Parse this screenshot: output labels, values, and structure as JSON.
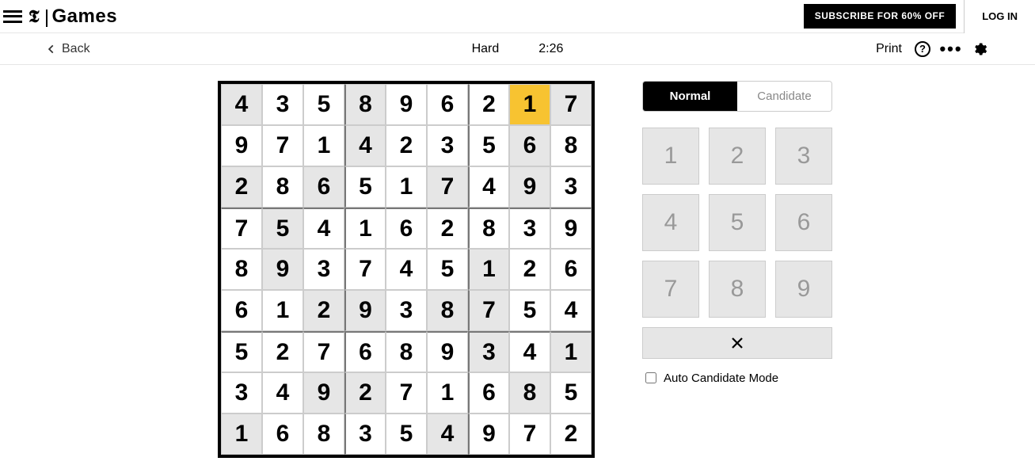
{
  "header": {
    "brandPrefix": "𝕿",
    "brandWord": "Games",
    "subscribe": "SUBSCRIBE FOR 60% OFF",
    "login": "LOG IN"
  },
  "toolbar": {
    "back": "Back",
    "difficulty": "Hard",
    "timer": "2:26",
    "print": "Print",
    "help": "?",
    "more": "•••"
  },
  "modes": {
    "normal": "Normal",
    "candidate": "Candidate",
    "active": "normal"
  },
  "numpad": [
    "1",
    "2",
    "3",
    "4",
    "5",
    "6",
    "7",
    "8",
    "9"
  ],
  "auto_label": "Auto Candidate Mode",
  "auto_checked": false,
  "selected": [
    0,
    7
  ],
  "board": [
    [
      {
        "v": "4",
        "p": true
      },
      {
        "v": "3",
        "p": false
      },
      {
        "v": "5",
        "p": false
      },
      {
        "v": "8",
        "p": true
      },
      {
        "v": "9",
        "p": false
      },
      {
        "v": "6",
        "p": false
      },
      {
        "v": "2",
        "p": false
      },
      {
        "v": "1",
        "p": false
      },
      {
        "v": "7",
        "p": true
      }
    ],
    [
      {
        "v": "9",
        "p": false
      },
      {
        "v": "7",
        "p": false
      },
      {
        "v": "1",
        "p": false
      },
      {
        "v": "4",
        "p": true
      },
      {
        "v": "2",
        "p": false
      },
      {
        "v": "3",
        "p": false
      },
      {
        "v": "5",
        "p": false
      },
      {
        "v": "6",
        "p": true
      },
      {
        "v": "8",
        "p": false
      }
    ],
    [
      {
        "v": "2",
        "p": true
      },
      {
        "v": "8",
        "p": false
      },
      {
        "v": "6",
        "p": true
      },
      {
        "v": "5",
        "p": false
      },
      {
        "v": "1",
        "p": false
      },
      {
        "v": "7",
        "p": true
      },
      {
        "v": "4",
        "p": false
      },
      {
        "v": "9",
        "p": true
      },
      {
        "v": "3",
        "p": false
      }
    ],
    [
      {
        "v": "7",
        "p": false
      },
      {
        "v": "5",
        "p": true
      },
      {
        "v": "4",
        "p": false
      },
      {
        "v": "1",
        "p": false
      },
      {
        "v": "6",
        "p": false
      },
      {
        "v": "2",
        "p": false
      },
      {
        "v": "8",
        "p": false
      },
      {
        "v": "3",
        "p": false
      },
      {
        "v": "9",
        "p": false
      }
    ],
    [
      {
        "v": "8",
        "p": false
      },
      {
        "v": "9",
        "p": true
      },
      {
        "v": "3",
        "p": false
      },
      {
        "v": "7",
        "p": false
      },
      {
        "v": "4",
        "p": false
      },
      {
        "v": "5",
        "p": false
      },
      {
        "v": "1",
        "p": true
      },
      {
        "v": "2",
        "p": false
      },
      {
        "v": "6",
        "p": false
      }
    ],
    [
      {
        "v": "6",
        "p": false
      },
      {
        "v": "1",
        "p": false
      },
      {
        "v": "2",
        "p": true
      },
      {
        "v": "9",
        "p": true
      },
      {
        "v": "3",
        "p": false
      },
      {
        "v": "8",
        "p": true
      },
      {
        "v": "7",
        "p": true
      },
      {
        "v": "5",
        "p": false
      },
      {
        "v": "4",
        "p": false
      }
    ],
    [
      {
        "v": "5",
        "p": false
      },
      {
        "v": "2",
        "p": false
      },
      {
        "v": "7",
        "p": false
      },
      {
        "v": "6",
        "p": false
      },
      {
        "v": "8",
        "p": false
      },
      {
        "v": "9",
        "p": false
      },
      {
        "v": "3",
        "p": true
      },
      {
        "v": "4",
        "p": false
      },
      {
        "v": "1",
        "p": true
      }
    ],
    [
      {
        "v": "3",
        "p": false
      },
      {
        "v": "4",
        "p": false
      },
      {
        "v": "9",
        "p": true
      },
      {
        "v": "2",
        "p": true
      },
      {
        "v": "7",
        "p": false
      },
      {
        "v": "1",
        "p": false
      },
      {
        "v": "6",
        "p": false
      },
      {
        "v": "8",
        "p": true
      },
      {
        "v": "5",
        "p": false
      }
    ],
    [
      {
        "v": "1",
        "p": true
      },
      {
        "v": "6",
        "p": false
      },
      {
        "v": "8",
        "p": false
      },
      {
        "v": "3",
        "p": false
      },
      {
        "v": "5",
        "p": false
      },
      {
        "v": "4",
        "p": true
      },
      {
        "v": "9",
        "p": false
      },
      {
        "v": "7",
        "p": false
      },
      {
        "v": "2",
        "p": false
      }
    ]
  ]
}
